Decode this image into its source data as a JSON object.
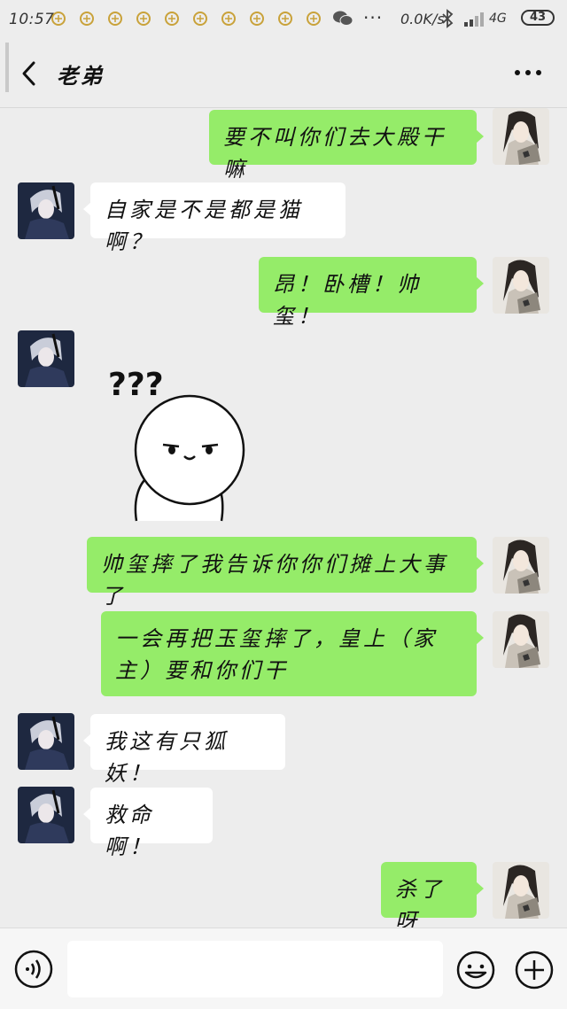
{
  "status_bar": {
    "time": "10:57",
    "more_indicator": "···",
    "network_speed": "0.0K/s",
    "network_type": "4G",
    "battery": "43"
  },
  "header": {
    "title": "老弟",
    "back_icon": "chevron-left-icon",
    "more_icon": "more-dots-icon"
  },
  "messages": [
    {
      "side": "right",
      "text": "要不叫你们去大殿干嘛"
    },
    {
      "side": "left",
      "text": "自家是不是都是猫啊？"
    },
    {
      "side": "right",
      "text": "昂！卧槽！帅玺！"
    },
    {
      "side": "left",
      "type": "sticker",
      "text": "???"
    },
    {
      "side": "right",
      "text": "帅玺摔了我告诉你你们摊上大事了"
    },
    {
      "side": "right",
      "text": "一会再把玉玺摔了，皇上（家主）要和你们干"
    },
    {
      "side": "left",
      "text": "我这有只狐妖！"
    },
    {
      "side": "left",
      "text": "救命啊！"
    },
    {
      "side": "right",
      "text": "杀了呀"
    }
  ],
  "input_bar": {
    "placeholder": "",
    "voice_icon": "voice-icon",
    "emoji_icon": "emoji-icon",
    "plus_icon": "plus-icon"
  },
  "colors": {
    "background": "#ededed",
    "bubble_self": "#95ec69",
    "bubble_other": "#ffffff"
  }
}
